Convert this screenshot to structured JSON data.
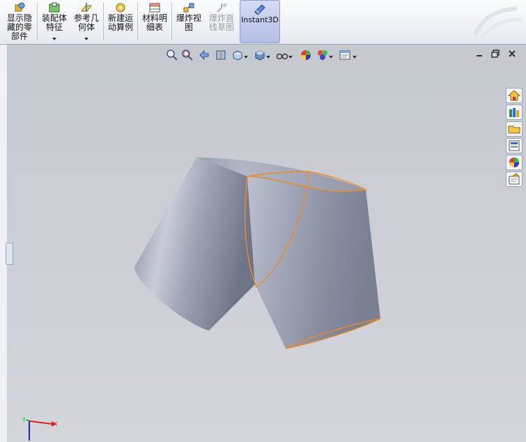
{
  "ribbon": {
    "buttons": [
      {
        "id": "show-hidden",
        "label": "显示隐\n藏的零\n部件",
        "icon": "show-hidden-components-icon"
      },
      {
        "id": "assembly-features",
        "label": "装配体\n特征",
        "icon": "assembly-features-icon",
        "dropdown": true
      },
      {
        "id": "reference-geometry",
        "label": "参考几\n何体",
        "icon": "reference-geometry-icon",
        "dropdown": true
      },
      {
        "id": "new-motion-study",
        "label": "新建运\n动算例",
        "icon": "motion-study-icon"
      },
      {
        "id": "bom",
        "label": "材料明\n细表",
        "icon": "bill-of-materials-icon"
      },
      {
        "id": "exploded-view",
        "label": "爆炸视\n图",
        "icon": "exploded-view-icon"
      },
      {
        "id": "explode-line-sketch",
        "label": "爆炸直\n线草图",
        "icon": "explode-line-sketch-icon",
        "disabled": true
      },
      {
        "id": "instant3d",
        "label": "Instant3D",
        "icon": "instant3d-icon",
        "active": true
      }
    ]
  },
  "view_toolbar": [
    "zoom-to-fit-icon",
    "zoom-to-area-icon",
    "previous-view-icon",
    "section-view-icon",
    "view-orientation-icon",
    "display-style-icon",
    "hide-show-items-icon",
    "edit-appearance-icon",
    "apply-scene-icon",
    "view-settings-icon"
  ],
  "window_controls": [
    "minimize-icon",
    "restore-icon",
    "close-icon"
  ],
  "task_pane": [
    "home-icon",
    "design-library-icon",
    "file-explorer-icon",
    "view-palette-icon",
    "appearances-icon",
    "custom-properties-icon"
  ],
  "colors": {
    "accent": "#f08a24",
    "part": "#9aa0b4",
    "viewport": "#c9ccd3"
  },
  "triad": {
    "x_label": "X",
    "y_label": "Y"
  }
}
